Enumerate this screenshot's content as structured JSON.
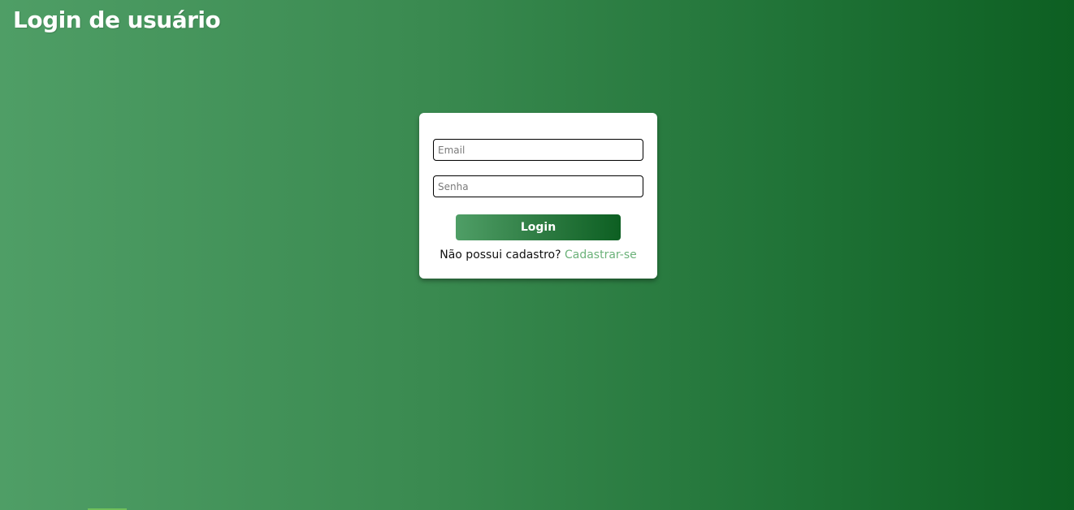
{
  "page": {
    "title": "Login de usuário"
  },
  "form": {
    "email_placeholder": "Email",
    "email_value": "",
    "password_placeholder": "Senha",
    "password_value": "",
    "login_label": "Login",
    "register_prompt": "Não possui cadastro?",
    "register_link": "Cadastrar-se"
  },
  "colors": {
    "background_start": "#4f9e66",
    "background_end": "#0d5f22",
    "link": "#6cb27a"
  }
}
